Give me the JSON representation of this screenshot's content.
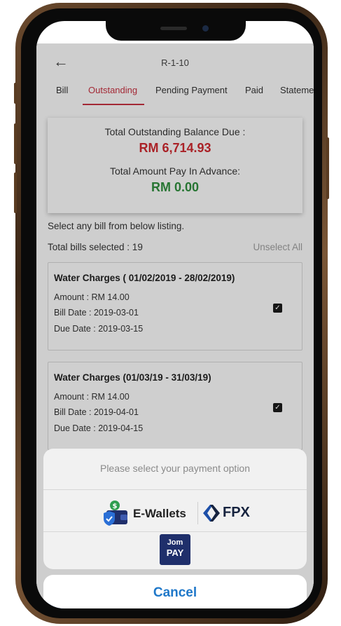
{
  "header": {
    "title": "R-1-10",
    "back_label": "←"
  },
  "tabs": [
    {
      "label": "Bill"
    },
    {
      "label": "Outstanding"
    },
    {
      "label": "Pending Payment"
    },
    {
      "label": "Paid"
    },
    {
      "label": "Stateme"
    }
  ],
  "summary": {
    "outstanding_label": "Total Outstanding Balance Due :",
    "outstanding_value": "RM 6,714.93",
    "advance_label": "Total Amount Pay In Advance:",
    "advance_value": "RM 0.00"
  },
  "listing": {
    "instruction": "Select any bill from below listing.",
    "selected_count": "Total bills selected : 19",
    "unselect_all": "Unselect All"
  },
  "bills": [
    {
      "title": "Water Charges ( 01/02/2019 - 28/02/2019)",
      "amount": "Amount : RM 14.00",
      "bill_date": "Bill Date : 2019-03-01",
      "due_date": "Due Date : 2019-03-15",
      "checked": true
    },
    {
      "title": "Water Charges (01/03/19 - 31/03/19)",
      "amount": "Amount : RM 14.00",
      "bill_date": "Bill Date : 2019-04-01",
      "due_date": "Due Date : 2019-04-15",
      "checked": true
    }
  ],
  "payment_sheet": {
    "title": "Please select your payment option",
    "ewallets_label": "E-Wallets",
    "fpx_label": "FPX",
    "jompay_line1": "Jom",
    "jompay_line2": "PAY",
    "cancel_label": "Cancel"
  },
  "colors": {
    "accent_red": "#c0303f",
    "outstanding_red": "#c8282e",
    "advance_green": "#2e8a3c",
    "cancel_blue": "#1f78c9",
    "jompay_navy": "#1f2f6b"
  }
}
